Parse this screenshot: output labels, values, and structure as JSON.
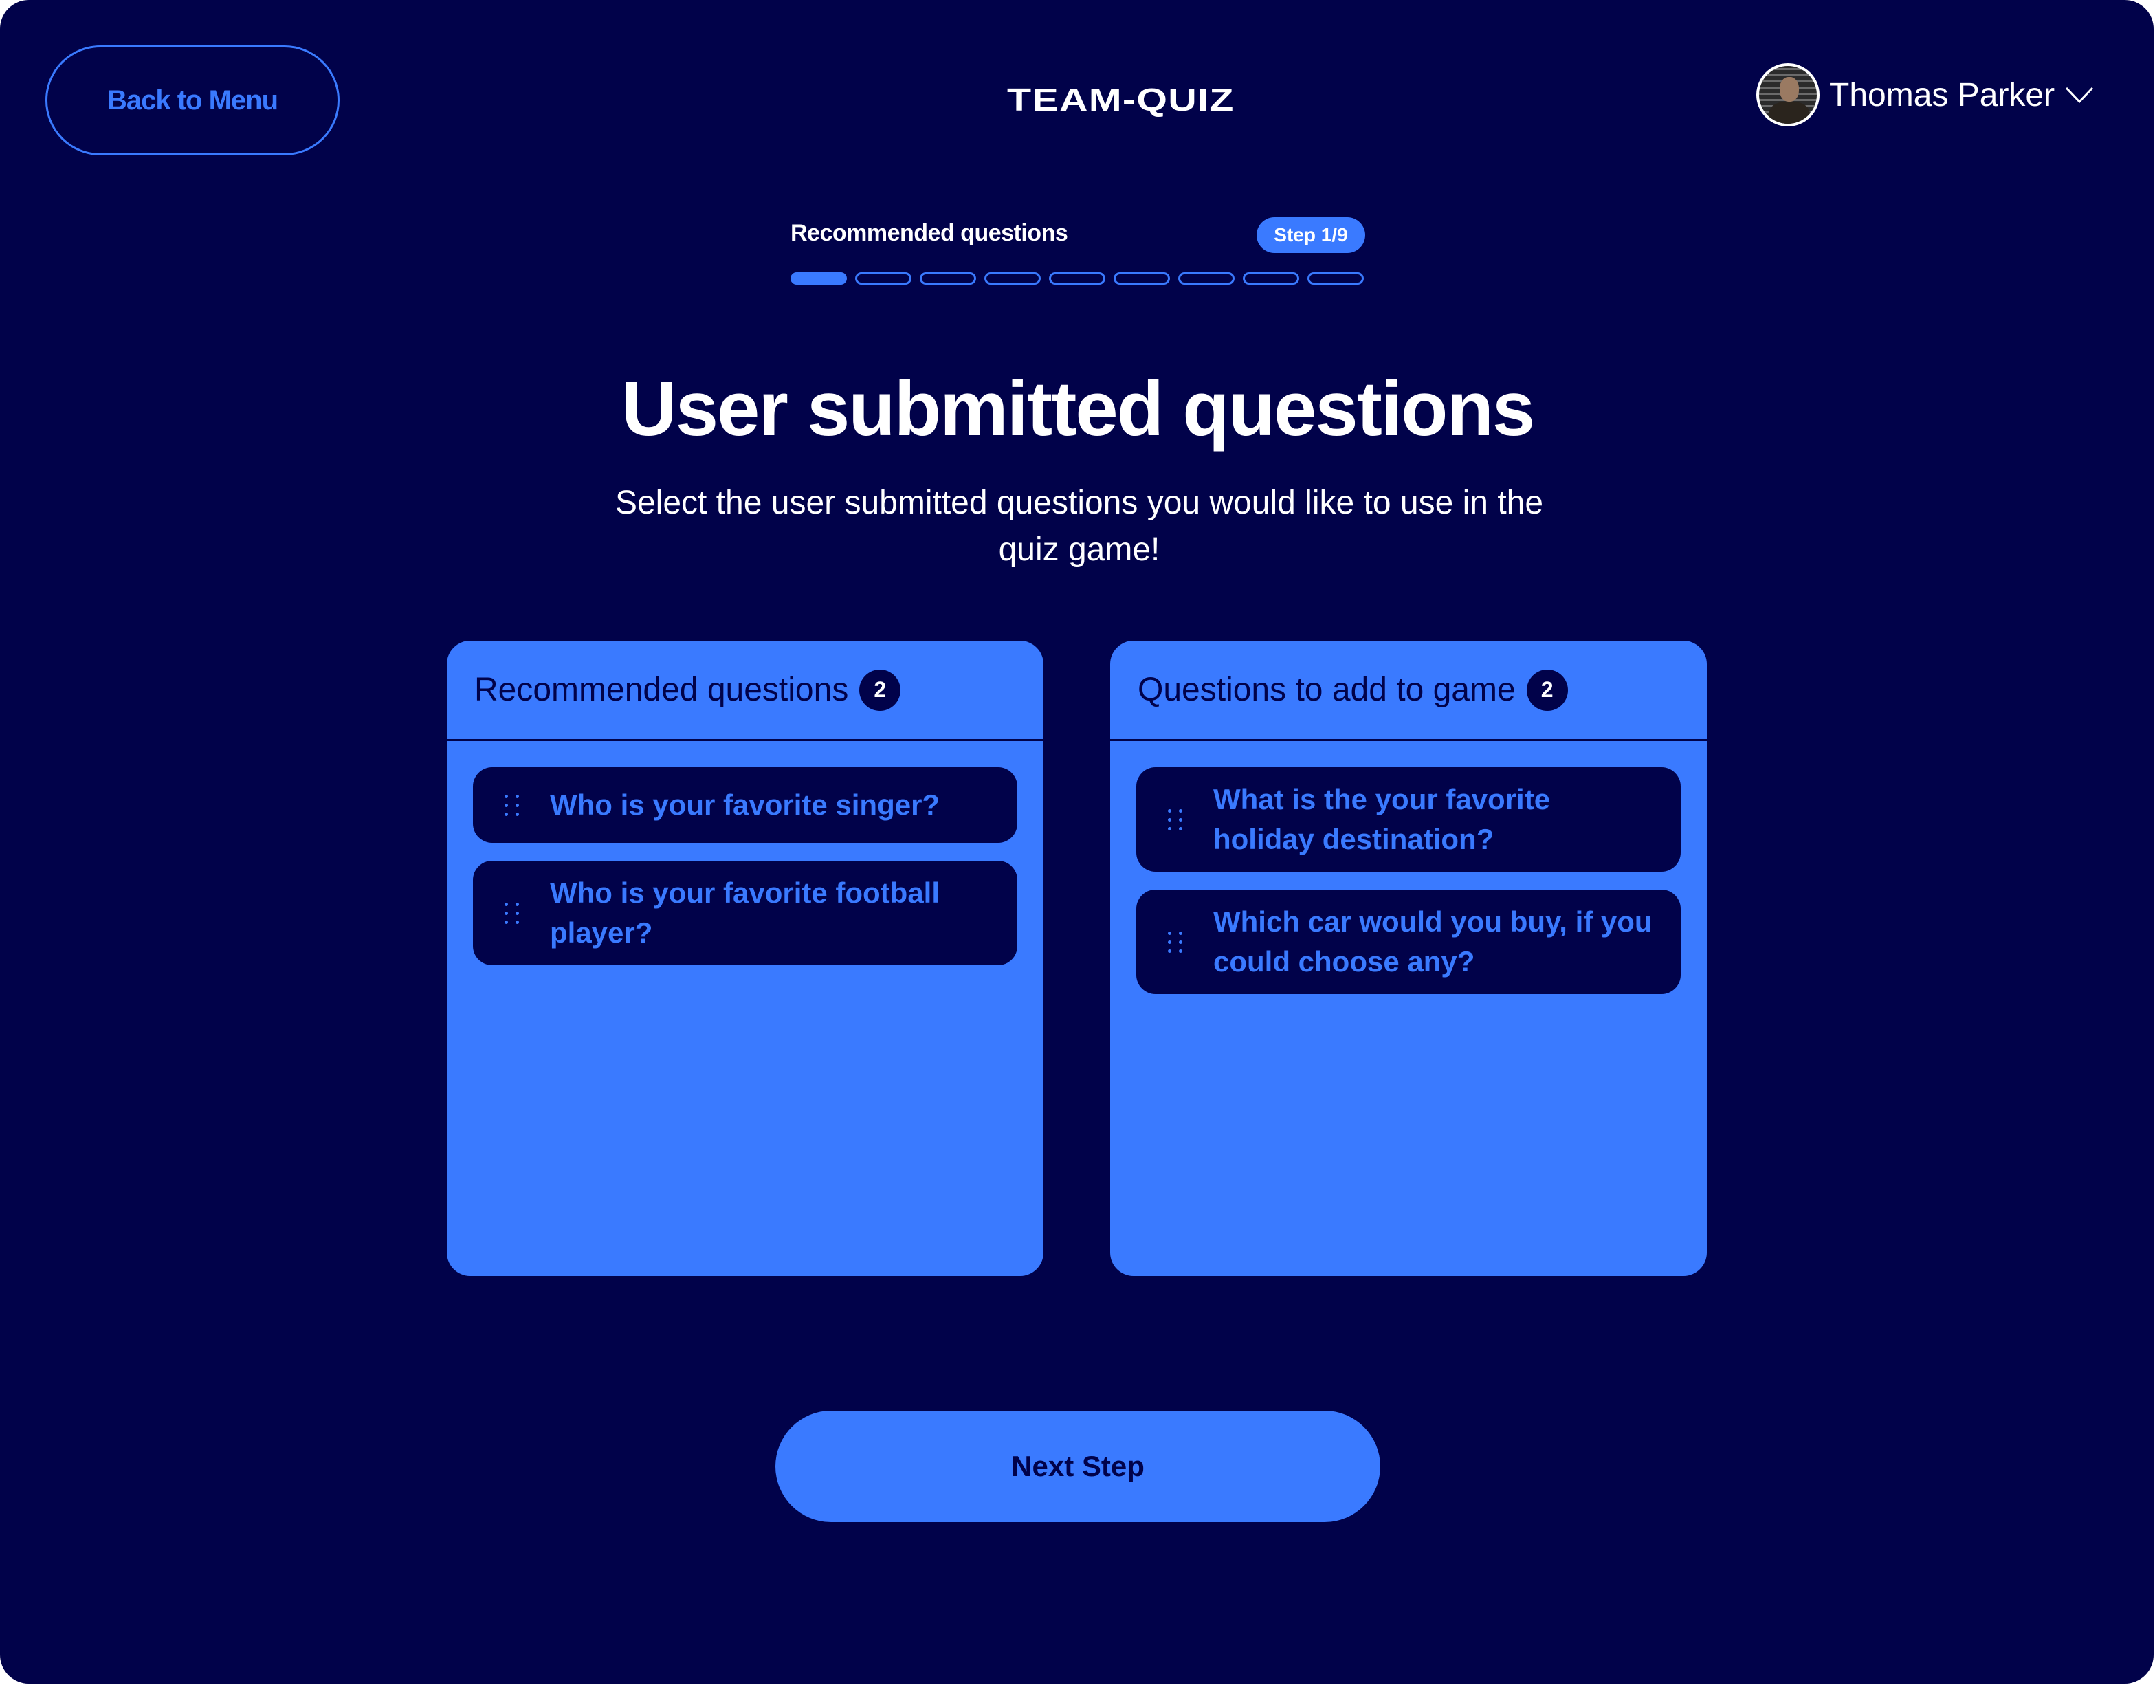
{
  "header": {
    "back_label": "Back to Menu",
    "logo": "TEAM-QUIZ",
    "user_name": "Thomas Parker"
  },
  "stepper": {
    "label": "Recommended questions",
    "badge": "Step 1/9",
    "current": 1,
    "total": 9
  },
  "main": {
    "title": "User submitted questions",
    "subtitle": "Select the user submitted questions you would like to use in the quiz game!"
  },
  "panels": {
    "recommended": {
      "title": "Recommended questions",
      "count": "2",
      "items": [
        "Who is your favorite singer?",
        "Who is your favorite football player?"
      ]
    },
    "to_add": {
      "title": "Questions to add to game",
      "count": "2",
      "items": [
        "What is the your favorite holiday destination?",
        "Which car would you buy, if you could choose any?"
      ]
    }
  },
  "footer": {
    "next_label": "Next Step"
  },
  "colors": {
    "background": "#01024a",
    "accent": "#3a7aff",
    "text": "#ffffff"
  }
}
